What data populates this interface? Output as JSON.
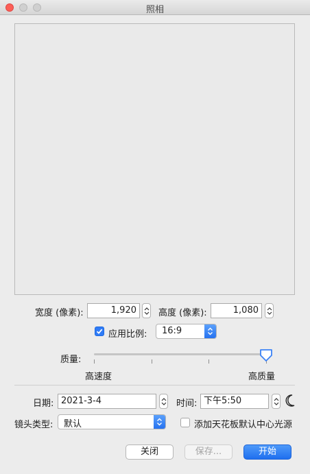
{
  "window": {
    "title": "照相"
  },
  "size": {
    "width_label": "宽度 (像素):",
    "width_value": "1,920",
    "height_label": "高度 (像素):",
    "height_value": "1,080"
  },
  "aspect": {
    "checkbox_label": "应用比例:",
    "checked": true,
    "ratio_value": "16:9"
  },
  "quality": {
    "label": "质量:",
    "low_label": "高速度",
    "high_label": "高质量",
    "level": 1.0
  },
  "datetime": {
    "date_label": "日期:",
    "date_value": "2021-3-4",
    "time_label": "时间:",
    "time_value": "下午5:50",
    "night_icon": "moon-icon"
  },
  "lens": {
    "label": "镜头类型:",
    "value": "默认",
    "default_light_label": "添加天花板默认中心光源",
    "default_light_checked": false
  },
  "buttons": {
    "close": "关闭",
    "save": "保存...",
    "start": "开始"
  },
  "colors": {
    "accent": "#2f7bf6",
    "close_traffic": "#fc5f57"
  }
}
